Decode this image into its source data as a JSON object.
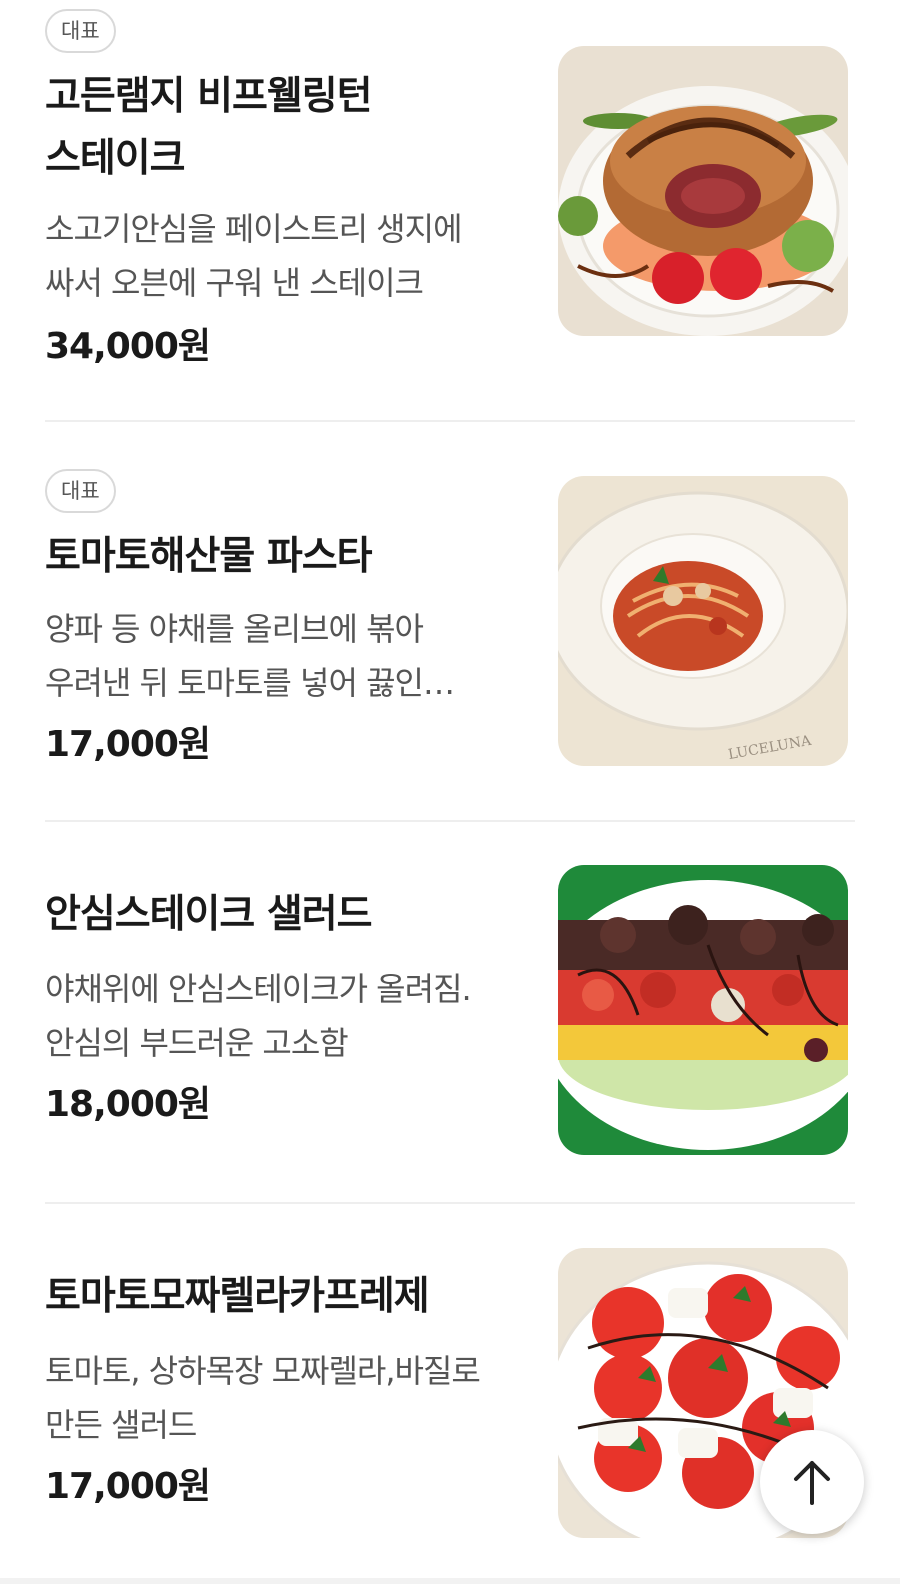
{
  "menu": {
    "items": [
      {
        "badge": "대표",
        "name": "고든램지 비프웰링턴 스테이크",
        "description": "소고기안심을 페이스트리 생지에 싸서 오븐에 구워 낸 스테이크",
        "price": "34,000원",
        "image_icon": "beef-wellington-photo"
      },
      {
        "badge": "대표",
        "name": "토마토해산물 파스타",
        "description": "양파 등 야채를 올리브에 볶아 우려낸 뒤 토마토를 넣어 끓인 파스타",
        "price": "17,000원",
        "image_icon": "seafood-pasta-photo",
        "image_watermark": "LUCELUNA"
      },
      {
        "name": "안심스테이크 샐러드",
        "description": "야채위에 안심스테이크가 올려짐. 안심의 부드러운 고소함",
        "price": "18,000원",
        "image_icon": "steak-salad-photo"
      },
      {
        "name": "토마토모짜렐라카프레제",
        "description": "토마토, 상하목장 모짜렐라,바질로 만든 샐러드",
        "price": "17,000원",
        "image_icon": "caprese-salad-photo"
      }
    ]
  },
  "scroll_top": {
    "icon": "arrow-up-icon"
  },
  "colors": {
    "text": "#1a1a1a",
    "subtext": "#555555",
    "divider": "#eeeeee",
    "badge_border": "#d9d9d9"
  }
}
